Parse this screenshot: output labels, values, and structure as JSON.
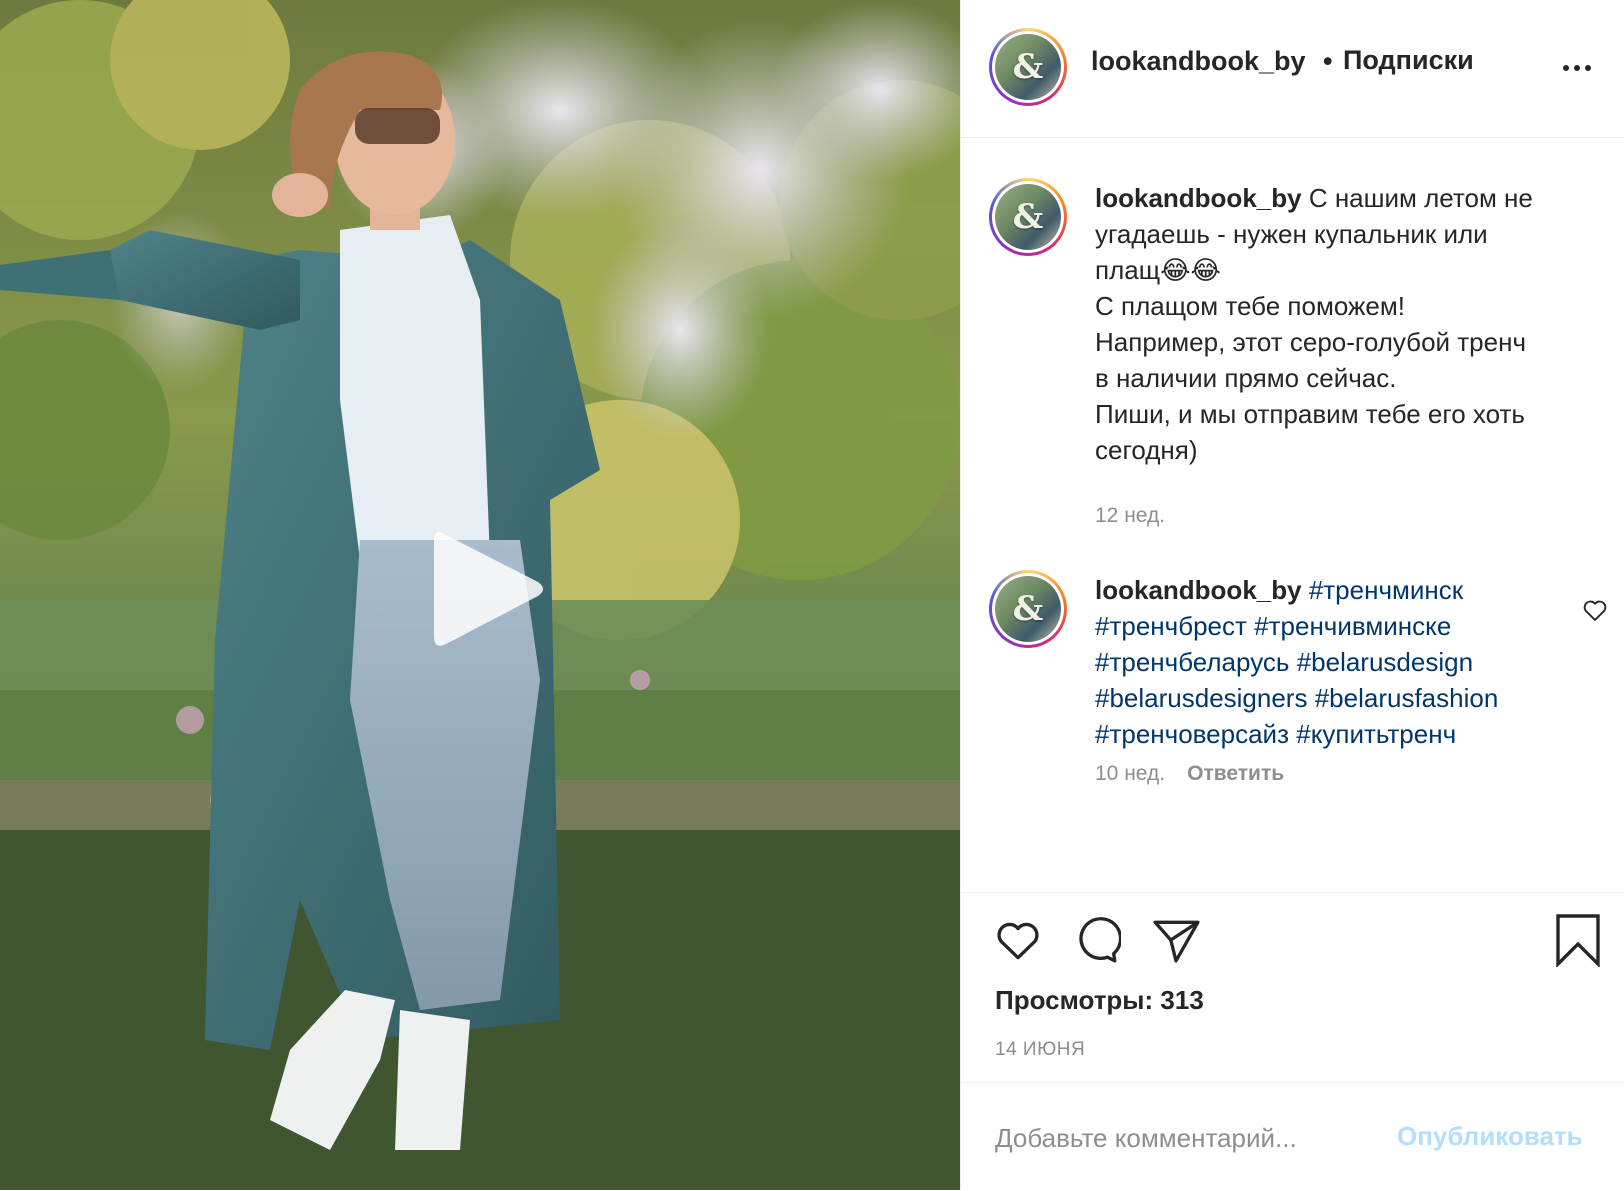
{
  "post": {
    "username": "lookandbook_by",
    "follow_separator": "•",
    "follow_label": "Подписки",
    "avatar_glyph": "&"
  },
  "comments": [
    {
      "username": "lookandbook_by",
      "lines": [
        "С нашим летом не",
        "угадаешь - нужен купальник или",
        "плащ😂😂",
        "С плащом тебе поможем!",
        "Например, этот серо-голубой тренч",
        "в наличии прямо сейчас.",
        "Пиши, и мы отправим тебе его хоть",
        "сегодня)"
      ],
      "age": "12 нед."
    },
    {
      "username": "lookandbook_by",
      "hashtags": [
        "#тренчминск",
        "#тренчбрест",
        "#тренчивминске",
        "#тренчбеларусь",
        "#belarusdesign",
        "#belarusdesigners",
        "#belarusfashion",
        "#тренчоверсайз",
        "#купитьтренч"
      ],
      "age": "10 нед.",
      "reply_label": "Ответить"
    }
  ],
  "stats": {
    "views_label": "Просмотры: 313",
    "date": "14 ИЮНЯ"
  },
  "comment_bar": {
    "placeholder": "Добавьте комментарий...",
    "publish_label": "Опубликовать"
  },
  "icons": {
    "like": "heart-icon",
    "comment": "comment-icon",
    "share": "paper-plane-icon",
    "save": "bookmark-icon",
    "play": "play-icon",
    "more": "ellipsis-icon"
  },
  "colors": {
    "text": "#262626",
    "secondary": "#8e8e8e",
    "hashtag": "#00376b",
    "publish_disabled": "#b2dffc",
    "divider": "#efefef"
  }
}
